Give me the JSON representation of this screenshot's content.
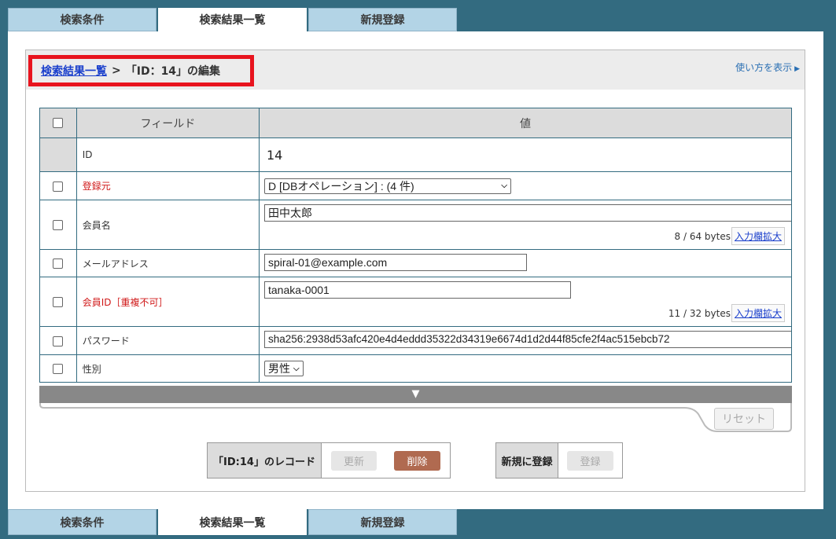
{
  "tabs": [
    "検索条件",
    "検索結果一覧",
    "新規登録"
  ],
  "breadcrumb": {
    "link": "検索結果一覧",
    "sep": ">",
    "current": "「ID：14」の編集"
  },
  "help_link": "使い方を表示",
  "table": {
    "headers": {
      "field": "フィールド",
      "value": "値"
    },
    "rows": {
      "id": {
        "label": "ID",
        "value": "14"
      },
      "source": {
        "label": "登録元",
        "value": "D [DBオペレーション] : (4 件)"
      },
      "member_name": {
        "label": "会員名",
        "value": "田中太郎",
        "bytes": "8 / 64 bytes",
        "expand": "入力欄拡大"
      },
      "email": {
        "label": "メールアドレス",
        "value": "spiral-01@example.com"
      },
      "member_id": {
        "label": "会員ID［重複不可］",
        "value": "tanaka-0001",
        "bytes": "11 / 32 bytes",
        "expand": "入力欄拡大"
      },
      "password": {
        "label": "パスワード",
        "value": "sha256:2938d53afc420e4d4eddd35322d34319e6674d1d2d44f85cfe2f4ac515ebcb72"
      },
      "gender": {
        "label": "性別",
        "value": "男性"
      }
    }
  },
  "more_arrow": "▼",
  "reset_label": "リセット",
  "record_actions": {
    "label": "「ID:14」のレコード",
    "update": "更新",
    "delete": "削除"
  },
  "new_actions": {
    "label": "新規に登録",
    "register": "登録"
  },
  "colors": {
    "background": "#336b80",
    "tab": "#b3d4e6",
    "highlight": "#e8141e",
    "delete": "#b06a50",
    "required": "#d01818"
  }
}
